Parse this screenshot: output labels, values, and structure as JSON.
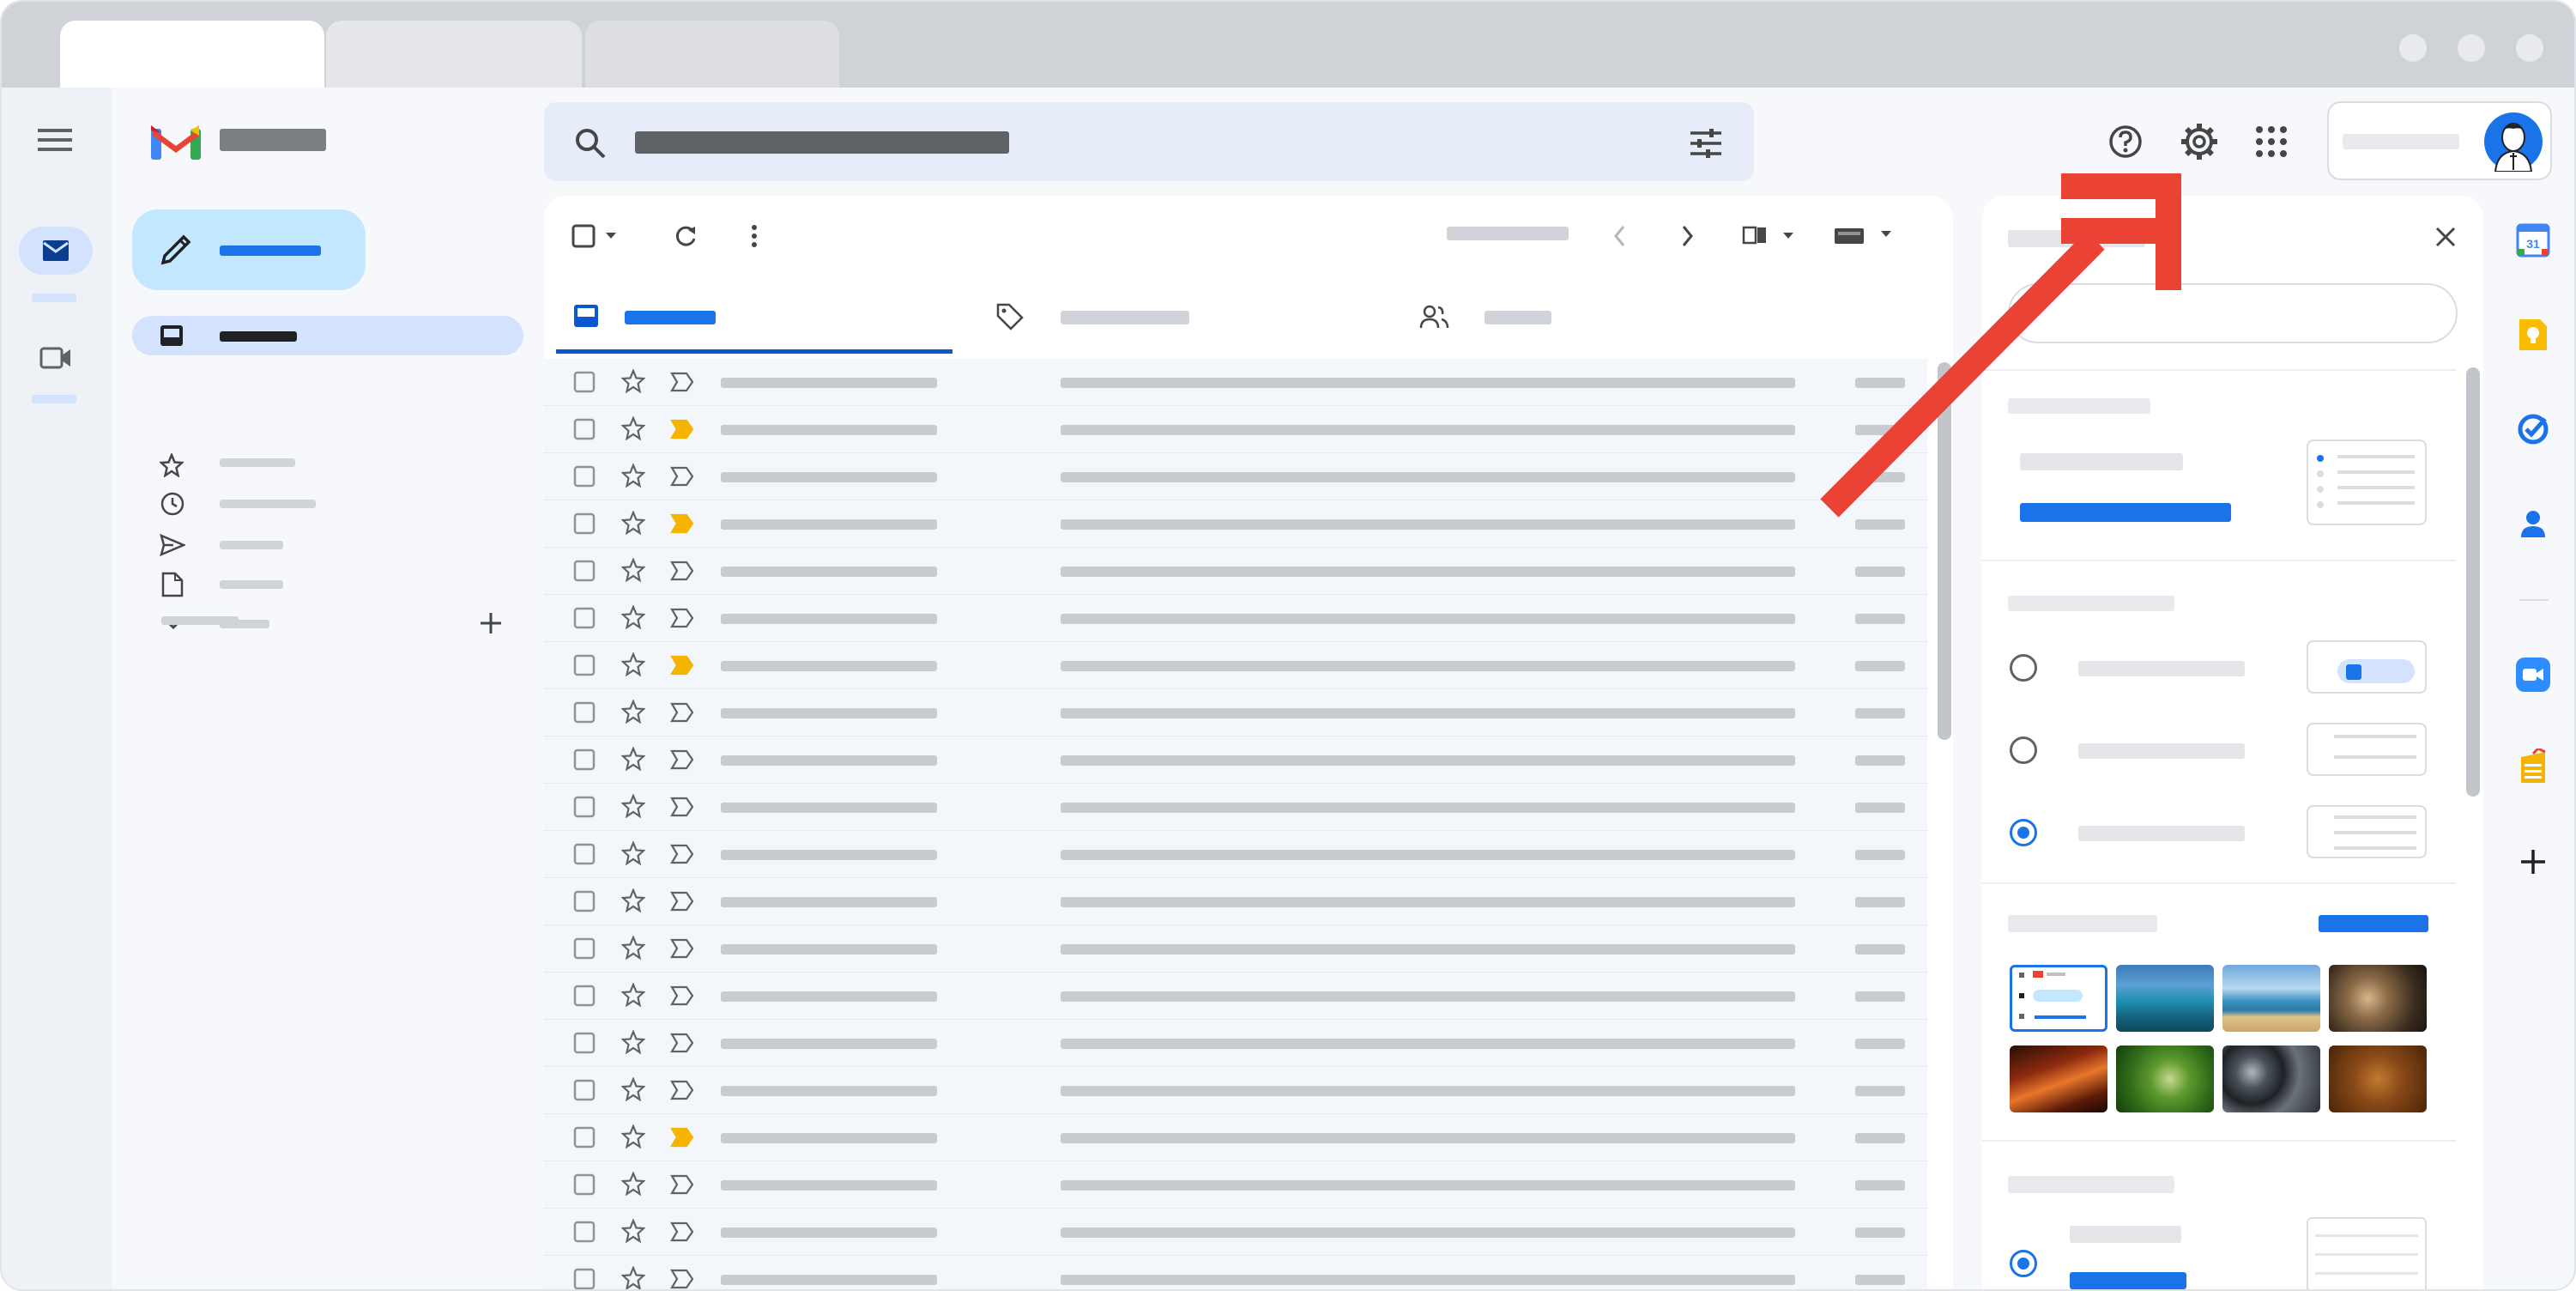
{
  "browser": {
    "tabs": [
      "",
      "",
      ""
    ]
  },
  "gmail": {
    "logo_text": "",
    "search_placeholder": "",
    "compose_label": "",
    "nav": [
      "",
      "",
      "",
      "",
      "",
      ""
    ],
    "labels_heading": ""
  },
  "toolbar": {
    "page_count": ""
  },
  "categories": [
    "",
    "",
    ""
  ],
  "emails": {
    "count": 20,
    "important_rows": [
      1,
      3,
      6,
      16
    ]
  },
  "quick_settings": {
    "title": "",
    "search_placeholder": "",
    "density_title": "",
    "density_link": "",
    "inbox_type_title": "",
    "inbox_options": [
      "",
      "",
      ""
    ],
    "inbox_selected": 2,
    "theme_title": "",
    "theme_link": "",
    "reading_pane_title": ""
  },
  "colors": {
    "accent": "#1a73e8",
    "compose": "#c2e7ff",
    "active_nav": "#d3e3fd",
    "arrow": "#ea4335",
    "important": "#f4b400"
  },
  "icons": [
    "menu-icon",
    "mail-icon",
    "video-icon",
    "gmail-logo-icon",
    "search-icon",
    "filter-icon",
    "help-icon",
    "gear-icon",
    "apps-grid-icon",
    "avatar",
    "pencil-icon",
    "inbox-icon",
    "star-icon",
    "clock-icon",
    "send-icon",
    "draft-icon",
    "chevron-down-icon",
    "plus-icon",
    "checkbox-icon",
    "refresh-icon",
    "more-vert-icon",
    "chevron-left-icon",
    "chevron-right-icon",
    "split-pane-icon",
    "keyboard-icon",
    "tag-icon",
    "people-icon",
    "close-icon",
    "calendar-icon",
    "keep-icon",
    "tasks-icon",
    "contacts-icon",
    "zoom-icon",
    "sheet-app-icon",
    "add-icon"
  ]
}
